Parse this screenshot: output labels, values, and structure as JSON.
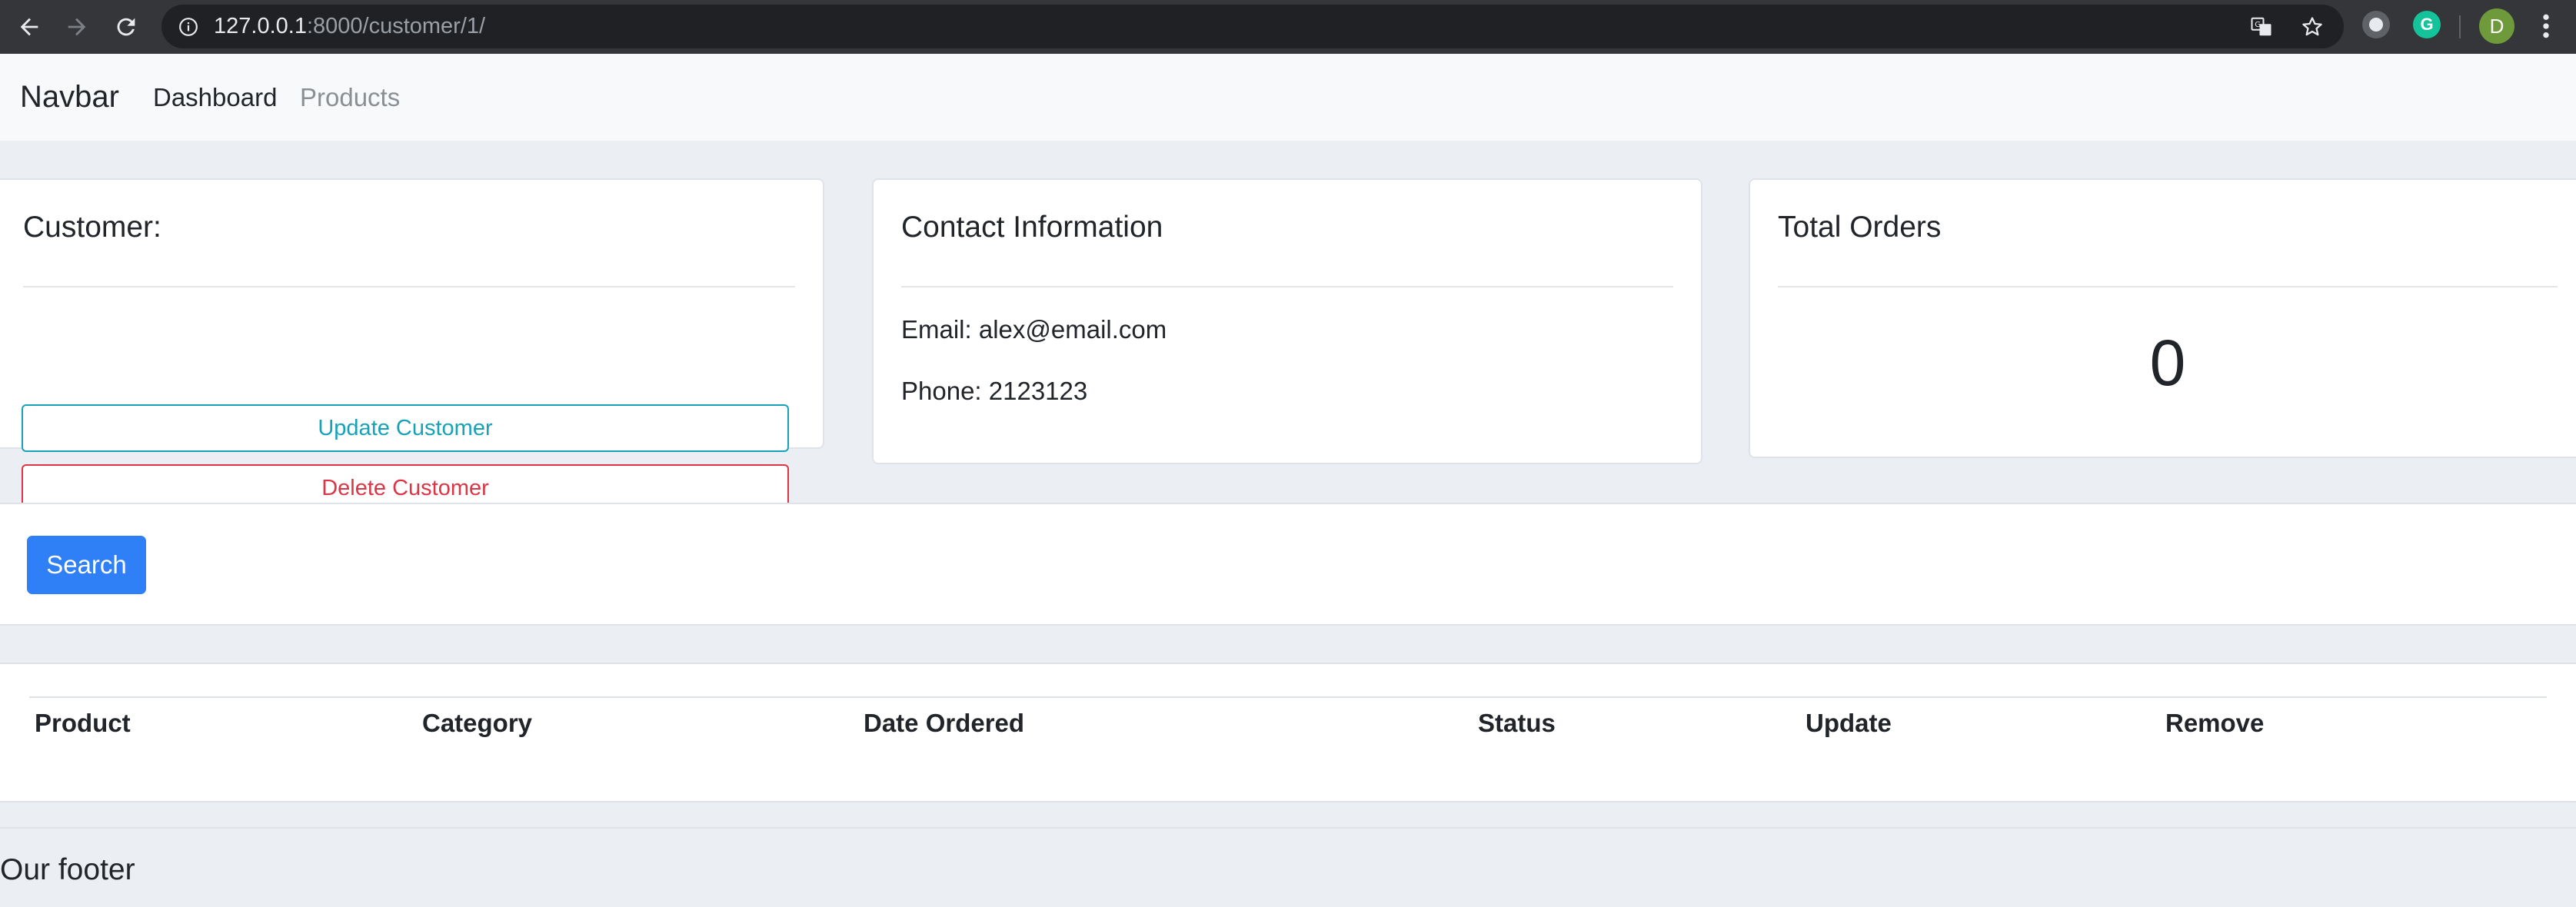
{
  "browser": {
    "url_host": "127.0.0.1",
    "url_rest": ":8000/customer/1/",
    "profile_initial": "D"
  },
  "navbar": {
    "brand": "Navbar",
    "links": [
      {
        "label": "Dashboard",
        "active": true
      },
      {
        "label": "Products",
        "active": false
      }
    ]
  },
  "customer_card": {
    "title": "Customer:",
    "update_label": "Update Customer",
    "delete_label": "Delete Customer"
  },
  "contact_card": {
    "title": "Contact Information",
    "email_line": "Email: alex@email.com",
    "phone_line": "Phone: 2123123"
  },
  "orders_card": {
    "title": "Total Orders",
    "count": "0"
  },
  "search": {
    "button_label": "Search"
  },
  "orders_table": {
    "headers": [
      "Product",
      "Category",
      "Date Ordered",
      "Status",
      "Update",
      "Remove"
    ]
  },
  "footer": {
    "text": "Our footer"
  },
  "colors": {
    "primary": "#2f7ff7",
    "info": "#17a2b8",
    "danger": "#dc3545",
    "page_bg": "#ebeef2"
  }
}
